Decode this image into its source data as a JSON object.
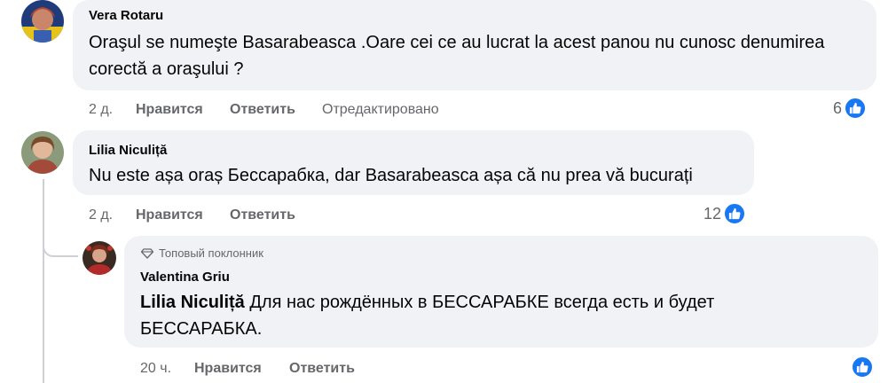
{
  "comments": [
    {
      "author": "Vera Rotaru",
      "text": "Oraşul se numeşte Basarabeasca .Oare cei ce au lucrat la acest panou nu cunosc denumirea corectă a oraşului ?",
      "time": "2 д.",
      "like_label": "Нравится",
      "reply_label": "Ответить",
      "edited_label": "Отредактировано",
      "reaction_count": "6"
    },
    {
      "author": "Lilia Niculiță",
      "text": "Nu este așa oraș Бессарабка, dar Basarabeasca așa că nu prea vă bucurați",
      "time": "2 д.",
      "like_label": "Нравится",
      "reply_label": "Ответить",
      "reaction_count": "12"
    }
  ],
  "reply": {
    "badge": "Топовый поклонник",
    "author": "Valentina Griu",
    "mention": "Lilia Niculiță",
    "text": " Для нас рождённых в БЕССАРАБКЕ всегда есть и будет БЕССАРАБКА.",
    "time": "20 ч.",
    "like_label": "Нравится",
    "reply_label": "Ответить"
  },
  "colors": {
    "like_blue": "#1877f2",
    "bubble_bg": "#f0f2f5",
    "meta_gray": "#65676b"
  },
  "icons": [
    "thumbs-up-icon",
    "diamond-fan-icon"
  ]
}
